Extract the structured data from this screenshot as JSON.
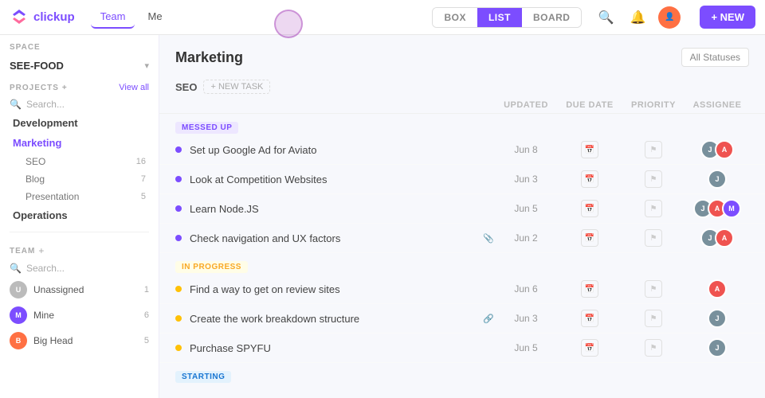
{
  "app": {
    "logo_text": "clickup",
    "nav_tabs": [
      {
        "label": "Team",
        "active": true
      },
      {
        "label": "Me",
        "active": false
      }
    ],
    "view_tabs": [
      {
        "label": "BOX",
        "active": false
      },
      {
        "label": "LIST",
        "active": true
      },
      {
        "label": "BOARD",
        "active": false
      }
    ],
    "new_button": "+ NEW"
  },
  "sidebar": {
    "space_label": "SPACE",
    "space_name": "SEE-FOOD",
    "projects_label": "PROJECTS",
    "view_all": "View all",
    "search_placeholder": "Search...",
    "nav_items": [
      {
        "label": "Development",
        "active": false,
        "count": null
      },
      {
        "label": "Marketing",
        "active": true,
        "count": null
      }
    ],
    "sub_items": [
      {
        "label": "SEO",
        "count": "16",
        "active": false
      },
      {
        "label": "Blog",
        "count": "7",
        "active": false
      },
      {
        "label": "Presentation",
        "count": "5",
        "active": false
      }
    ],
    "ops_label": "Operations",
    "team_label": "TEAM",
    "team_search_placeholder": "Search...",
    "team_members": [
      {
        "name": "Unassigned",
        "count": "1",
        "color": "#bbb"
      },
      {
        "name": "Mine",
        "count": "6",
        "color": "#7c4dff"
      },
      {
        "name": "Big Head",
        "count": "5",
        "color": "#ff7043"
      }
    ]
  },
  "content": {
    "title": "Marketing",
    "status_filter": "All Statuses",
    "new_task_label": "+ NEW TASK",
    "columns": {
      "updated": "UPDATED",
      "due_date": "DUE DATE",
      "priority": "PRIORITY",
      "assignee": "ASSIGNEE"
    },
    "sections": [
      {
        "id": "messed-up",
        "badge": "MESSED UP",
        "badge_class": "badge-messed",
        "tasks": [
          {
            "name": "Set up Google Ad for Aviato",
            "updated": "Jun 8",
            "dot": "dot-purple",
            "assignees": [
              {
                "color": "#78909c"
              },
              {
                "color": "#ef5350"
              }
            ],
            "has_icon": false
          },
          {
            "name": "Look at Competition Websites",
            "updated": "Jun 3",
            "dot": "dot-purple",
            "assignees": [
              {
                "color": "#78909c"
              }
            ],
            "has_icon": false
          },
          {
            "name": "Learn Node.JS",
            "updated": "Jun 5",
            "dot": "dot-purple",
            "assignees": [
              {
                "color": "#78909c"
              },
              {
                "color": "#ef5350"
              },
              {
                "color": "#7c4dff"
              }
            ],
            "has_icon": false
          },
          {
            "name": "Check navigation and UX factors",
            "updated": "Jun 2",
            "dot": "dot-purple",
            "assignees": [
              {
                "color": "#78909c"
              },
              {
                "color": "#ef5350"
              }
            ],
            "has_icon": true
          }
        ]
      },
      {
        "id": "in-progress",
        "badge": "IN PROGRESS",
        "badge_class": "badge-in-progress",
        "tasks": [
          {
            "name": "Find a way to get on review sites",
            "updated": "Jun 6",
            "dot": "dot-yellow",
            "assignees": [
              {
                "color": "#ef5350"
              }
            ],
            "has_icon": false
          },
          {
            "name": "Create the work breakdown structure",
            "updated": "Jun 3",
            "dot": "dot-yellow",
            "assignees": [
              {
                "color": "#78909c"
              }
            ],
            "has_icon": true
          },
          {
            "name": "Purchase SPYFU",
            "updated": "Jun 5",
            "dot": "dot-yellow",
            "assignees": [
              {
                "color": "#78909c"
              }
            ],
            "has_icon": false
          }
        ]
      },
      {
        "id": "starting",
        "badge": "STARTING",
        "badge_class": "badge-starting",
        "tasks": []
      }
    ]
  }
}
